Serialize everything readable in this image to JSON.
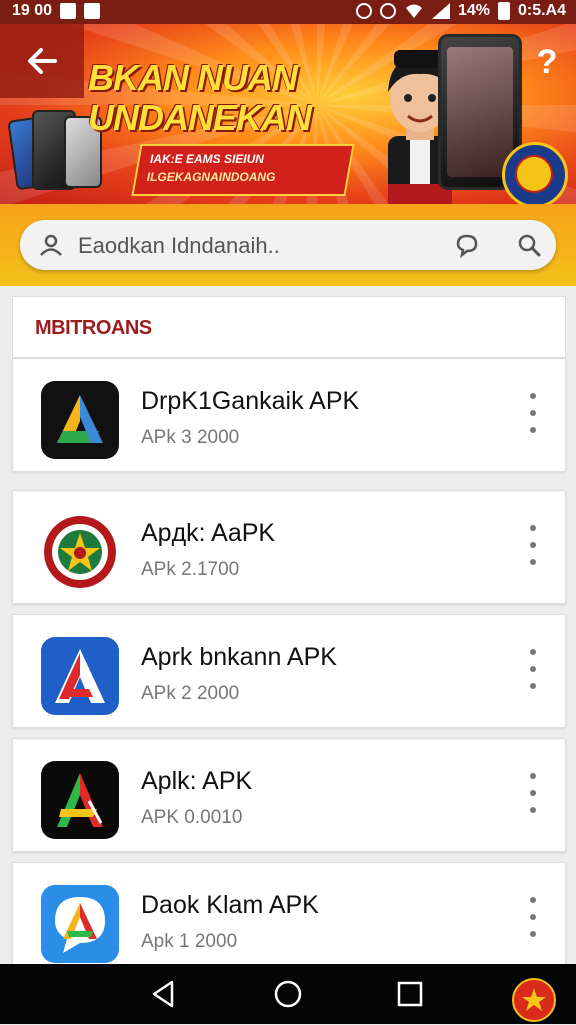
{
  "status_bar": {
    "time": "19 00",
    "battery": "14%",
    "clock_right": "0:5.A4"
  },
  "banner": {
    "headline_line1": "BKAN NUAN",
    "headline_line2": "UNDANEKAN",
    "ribbon_line1": "IAK:E EAMS SIEIUN",
    "ribbon_line2": "ILGEKAGNAINDOANG"
  },
  "search": {
    "placeholder": "Eaodkan Idndanaih.."
  },
  "section": {
    "title": "MBITROANS"
  },
  "apps": [
    {
      "name": "DrpK1Gankaik APK",
      "meta": "APk 3 2000",
      "icon": "a-arrow-icon"
    },
    {
      "name": "Apдk: AaPK",
      "meta": "APk 2.1700",
      "icon": "emblem-icon"
    },
    {
      "name": "Aprk bnkann APK",
      "meta": "APk 2 2000",
      "icon": "red-a-icon"
    },
    {
      "name": "Aplk: APK",
      "meta": "APK 0.0010",
      "icon": "dark-a-icon"
    },
    {
      "name": "Daok Klam APK",
      "meta": "Apk 1 2000",
      "icon": "chat-bubble-icon"
    }
  ],
  "colors": {
    "status_bar": "#7a1d12",
    "accent_orange": "#f7a21a",
    "section_title": "#9a1d1d",
    "nav_bar": "#050505"
  }
}
